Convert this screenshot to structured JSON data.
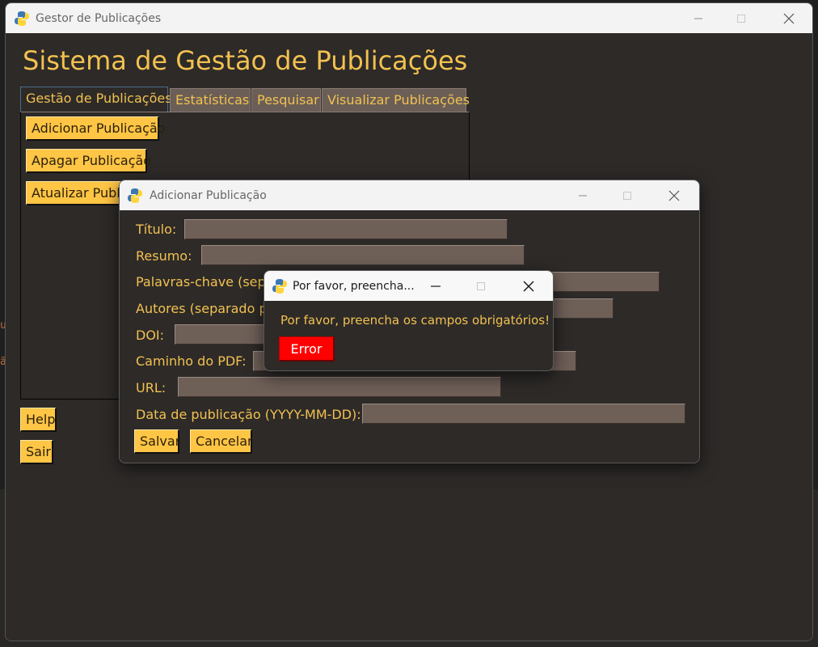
{
  "main_window": {
    "title": "Gestor de Publicações",
    "heading": "Sistema de Gestão de Publicações",
    "tabs": [
      {
        "label": "Gestão de Publicações",
        "active": true
      },
      {
        "label": "Estatísticas",
        "active": false
      },
      {
        "label": "Pesquisar",
        "active": false
      },
      {
        "label": "Visualizar Publicações",
        "active": false
      }
    ],
    "tab_buttons": {
      "add": "Adicionar Publicação",
      "delete": "Apagar Publicação",
      "update": "Atualizar Publicação"
    },
    "help_label": "Help",
    "exit_label": "Sair"
  },
  "add_dialog": {
    "title": "Adicionar Publicação",
    "fields": {
      "titulo": "Título:",
      "resumo": "Resumo:",
      "palavras": "Palavras-chave (separado por vírgula):",
      "autores": "Autores (separado por vírgula):",
      "doi": "DOI:",
      "pdf": "Caminho do PDF:",
      "url": "URL:",
      "data": "Data de publicação (YYYY-MM-DD):"
    },
    "save_label": "Salvar",
    "cancel_label": "Cancelar"
  },
  "alert_dialog": {
    "title": "Por favor, preencha...",
    "message": "Por favor, preencha os campos obrigatórios!",
    "button_label": "Error"
  },
  "colors": {
    "accent_text": "#f2c150",
    "button_bg": "#ffc545",
    "window_bg": "#2d2a28",
    "entry_bg": "#6e5f57",
    "error_button": "#ff0000"
  },
  "icons": [
    "python-icon",
    "minimize-icon",
    "maximize-icon",
    "close-icon"
  ]
}
